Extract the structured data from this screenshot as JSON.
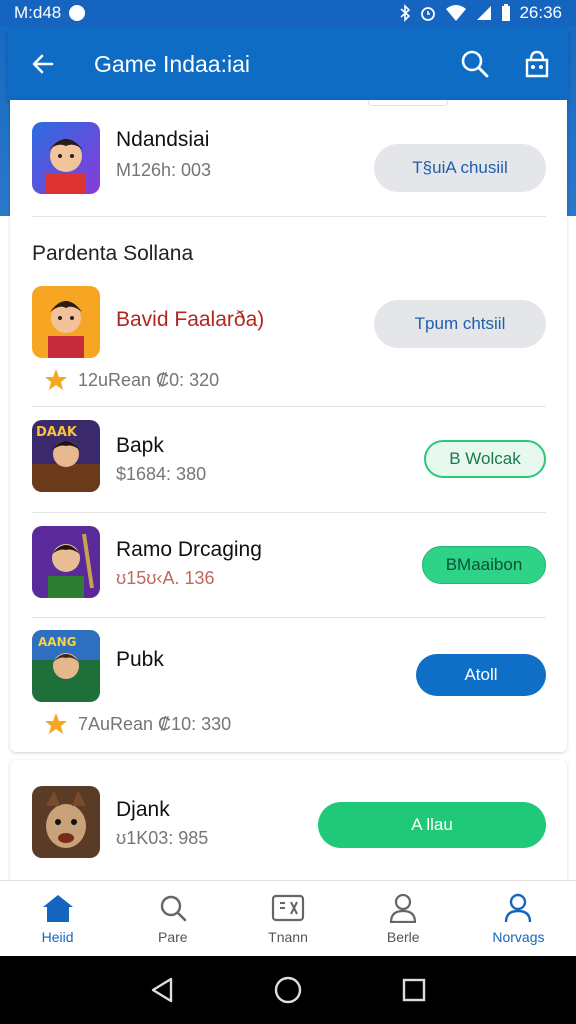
{
  "status": {
    "time_left": "M:d48",
    "time_right": "26:36"
  },
  "app_bar": {
    "title": "Game Indaa:iai"
  },
  "top_item": {
    "name": "Ndandsiai",
    "sub": "M126h: 003",
    "button": "T§uiA chusiil"
  },
  "section": {
    "title": "Pardenta Sollana"
  },
  "items": [
    {
      "name": "Bavid Faalarða)",
      "rating": "12uRean ₡0: 320",
      "button": "Tpum chtsiil"
    },
    {
      "name": "Bapk",
      "sub": "$1684: 380",
      "button": "B Wolcak"
    },
    {
      "name": "Ramo Drcaging",
      "sub": "ʊ15ʊ‹A. 136",
      "button": "BMaaibon"
    },
    {
      "name": "Pubk",
      "rating": "7AuRean ₡10: 330",
      "button": "Atoll"
    }
  ],
  "card2_item": {
    "name": "Djank",
    "sub": "ʊ1K03: 985",
    "button": "A llau"
  },
  "bottom_nav": [
    {
      "label": "Heiid",
      "icon": "home-icon"
    },
    {
      "label": "Pare",
      "icon": "search-icon"
    },
    {
      "label": "Tnann",
      "icon": "library-icon"
    },
    {
      "label": "Berle",
      "icon": "person-icon"
    },
    {
      "label": "Norvags",
      "icon": "account-icon"
    }
  ],
  "colors": {
    "primary": "#0e6cc4",
    "accent_green": "#2ed387",
    "star": "#f5a623"
  }
}
